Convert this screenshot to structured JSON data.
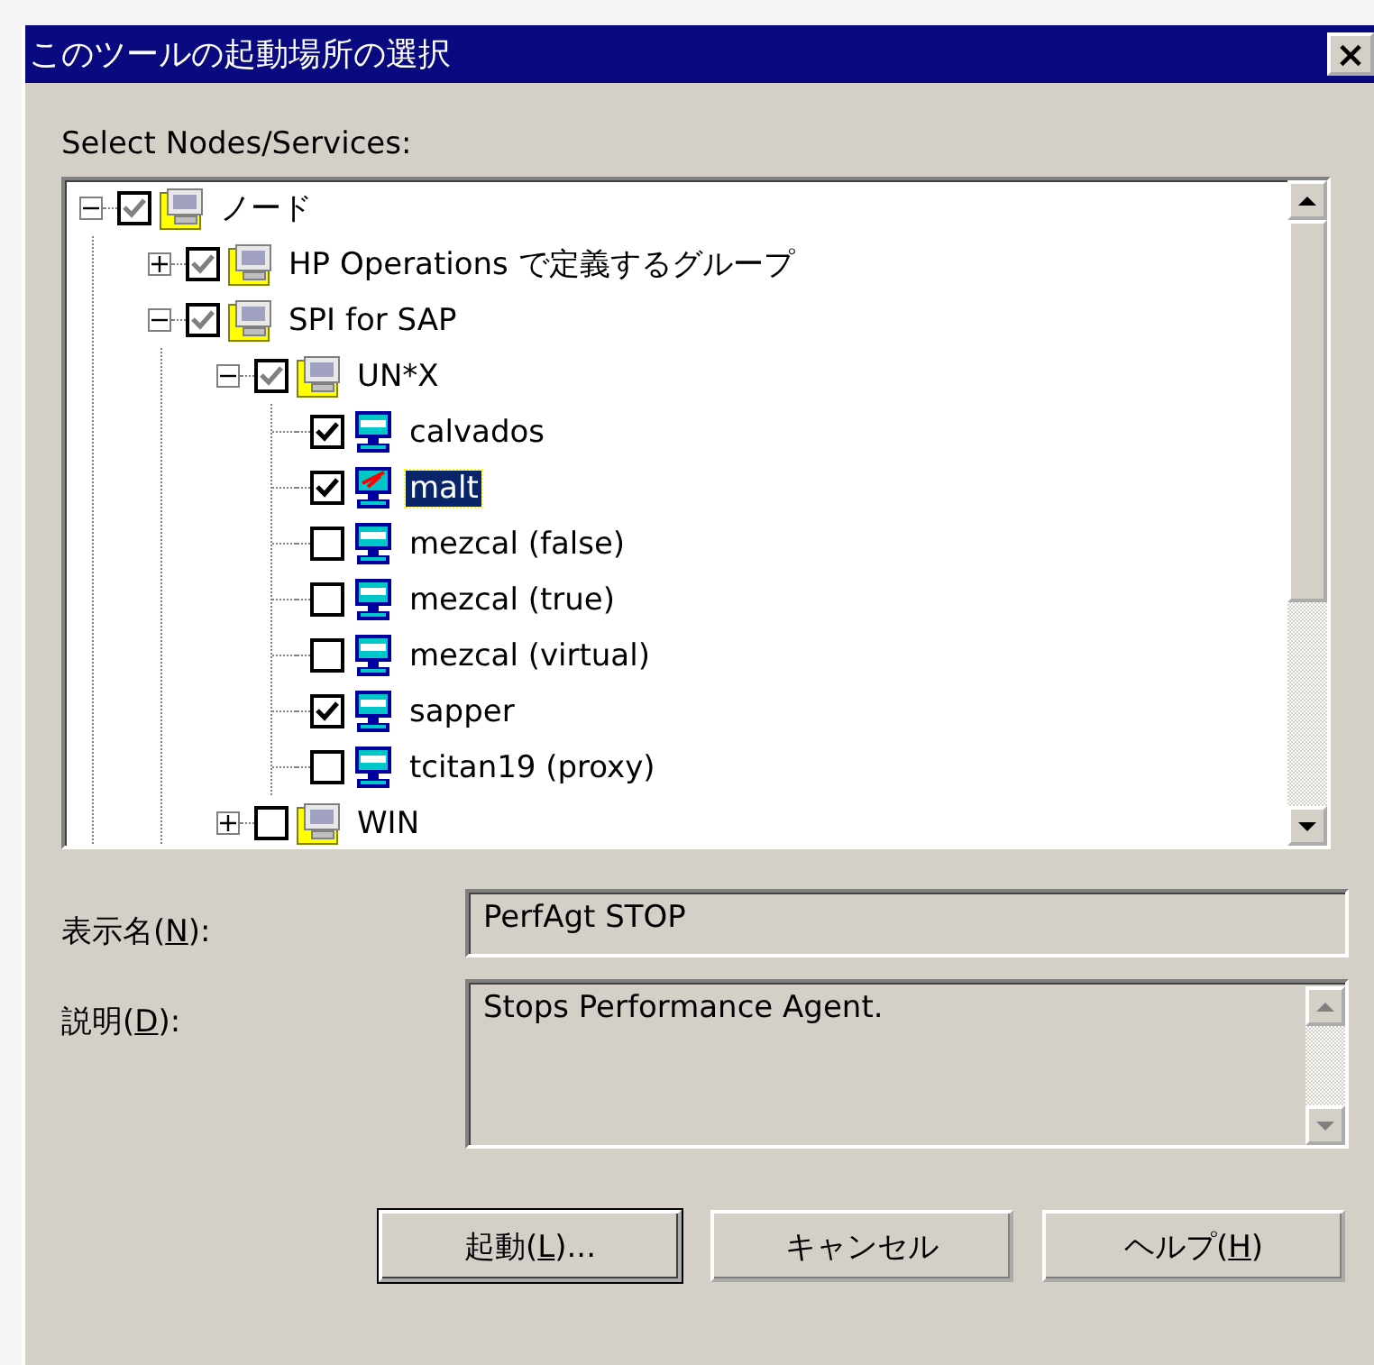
{
  "window": {
    "title": "このツールの起動場所の選択",
    "close": "×"
  },
  "tree_label": "Select Nodes/Services:",
  "tree": [
    {
      "label": "ノード",
      "kind": "group",
      "checked": true,
      "grayed": true,
      "expanded": true,
      "selected": false,
      "children": [
        {
          "label": "HP Operations で定義するグループ",
          "kind": "group",
          "checked": true,
          "grayed": true,
          "expanded": false,
          "selected": false
        },
        {
          "label": "SPI for SAP",
          "kind": "group",
          "checked": true,
          "grayed": true,
          "expanded": true,
          "selected": false,
          "children": [
            {
              "label": "UN*X",
              "kind": "group",
              "checked": true,
              "grayed": true,
              "expanded": true,
              "selected": false,
              "children": [
                {
                  "label": "calvados",
                  "kind": "node",
                  "checked": true,
                  "selected": false,
                  "alert": false
                },
                {
                  "label": "malt",
                  "kind": "node",
                  "checked": true,
                  "selected": true,
                  "alert": true
                },
                {
                  "label": "mezcal (false)",
                  "kind": "node",
                  "checked": false,
                  "selected": false,
                  "alert": false
                },
                {
                  "label": "mezcal (true)",
                  "kind": "node",
                  "checked": false,
                  "selected": false,
                  "alert": false
                },
                {
                  "label": "mezcal (virtual)",
                  "kind": "node",
                  "checked": false,
                  "selected": false,
                  "alert": false
                },
                {
                  "label": "sapper",
                  "kind": "node",
                  "checked": true,
                  "selected": false,
                  "alert": false
                },
                {
                  "label": "tcitan19 (proxy)",
                  "kind": "node",
                  "checked": false,
                  "selected": false,
                  "alert": false
                }
              ]
            },
            {
              "label": "WIN",
              "kind": "group",
              "checked": false,
              "grayed": false,
              "expanded": false,
              "selected": false
            }
          ]
        }
      ]
    }
  ],
  "fields": [
    {
      "label_parts": [
        "表示名(",
        "N",
        "):"
      ],
      "value": "PerfAgt STOP",
      "kind": "line"
    },
    {
      "label_parts": [
        "説明(",
        "D",
        "):"
      ],
      "value": "Stops Performance Agent.",
      "kind": "multiline"
    }
  ],
  "buttons": [
    {
      "label_parts": [
        "起動(",
        "L",
        ")..."
      ],
      "default": true
    },
    {
      "label_parts": [
        "キャンセル"
      ],
      "default": false
    },
    {
      "label_parts": [
        "ヘルプ(",
        "H",
        ")"
      ],
      "default": false
    }
  ]
}
